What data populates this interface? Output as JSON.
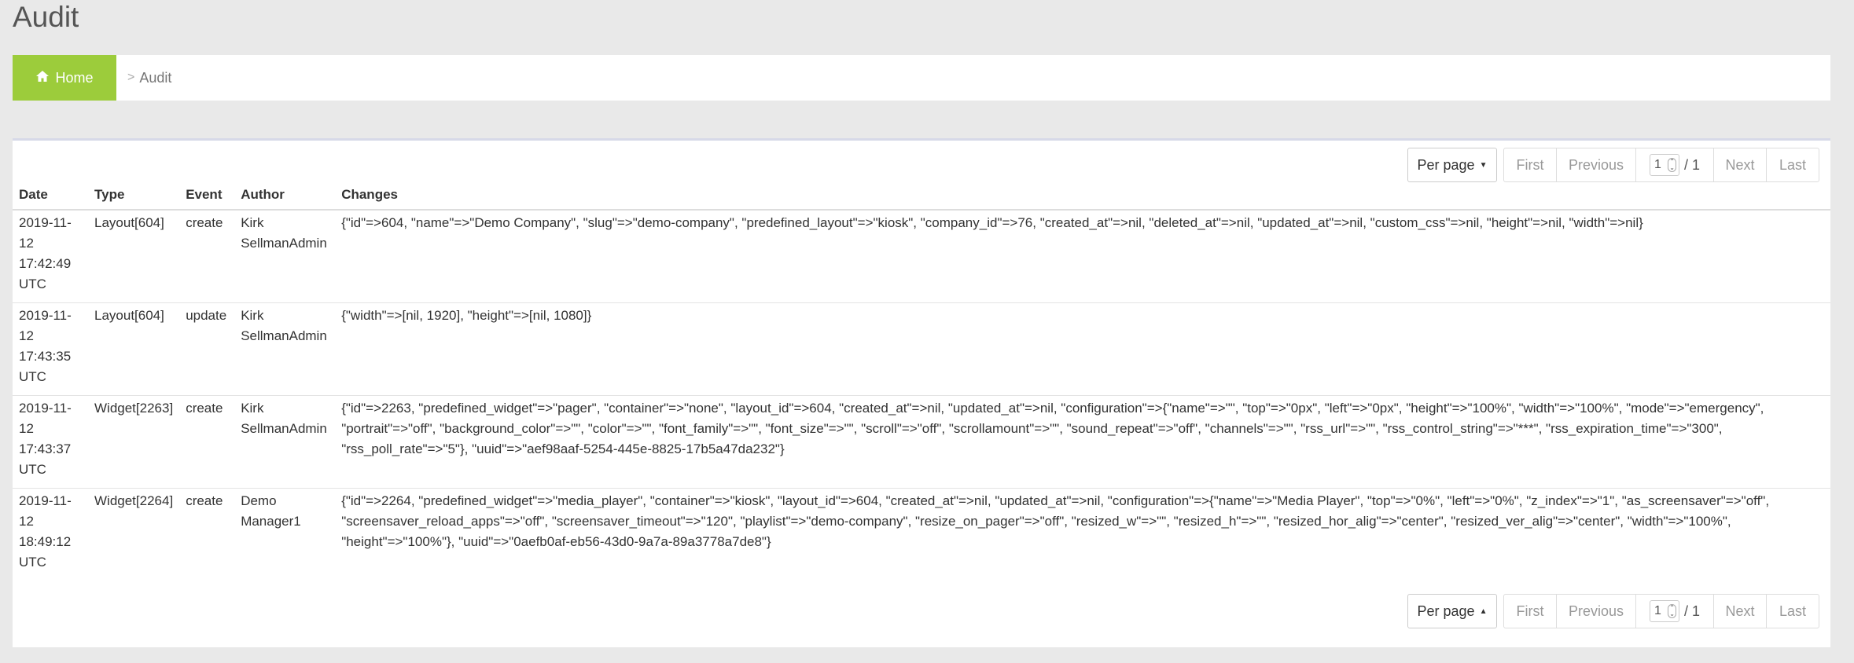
{
  "page": {
    "title": "Audit"
  },
  "breadcrumb": {
    "home": "Home",
    "separator": ">",
    "current": "Audit"
  },
  "pager": {
    "per_page": "Per page",
    "first": "First",
    "previous": "Previous",
    "page_value": "1",
    "page_total": "/ 1",
    "next": "Next",
    "last": "Last"
  },
  "table": {
    "headers": [
      "Date",
      "Type",
      "Event",
      "Author",
      "Changes"
    ],
    "rows": [
      {
        "date": [
          "2019-11-",
          "12",
          "17:42:49",
          "UTC"
        ],
        "type": "Layout[604]",
        "event": "create",
        "author": [
          "Kirk",
          "SellmanAdmin"
        ],
        "changes": "{\"id\"=>604, \"name\"=>\"Demo Company\", \"slug\"=>\"demo-company\", \"predefined_layout\"=>\"kiosk\", \"company_id\"=>76, \"created_at\"=>nil, \"deleted_at\"=>nil, \"updated_at\"=>nil, \"custom_css\"=>nil, \"height\"=>nil, \"width\"=>nil}"
      },
      {
        "date": [
          "2019-11-",
          "12",
          "17:43:35",
          "UTC"
        ],
        "type": "Layout[604]",
        "event": "update",
        "author": [
          "Kirk",
          "SellmanAdmin"
        ],
        "changes": "{\"width\"=>[nil, 1920], \"height\"=>[nil, 1080]}"
      },
      {
        "date": [
          "2019-11-",
          "12",
          "17:43:37",
          "UTC"
        ],
        "type": "Widget[2263]",
        "event": "create",
        "author": [
          "Kirk",
          "SellmanAdmin"
        ],
        "changes": "{\"id\"=>2263, \"predefined_widget\"=>\"pager\", \"container\"=>\"none\", \"layout_id\"=>604, \"created_at\"=>nil, \"updated_at\"=>nil, \"configuration\"=>{\"name\"=>\"\", \"top\"=>\"0px\", \"left\"=>\"0px\", \"height\"=>\"100%\", \"width\"=>\"100%\", \"mode\"=>\"emergency\", \"portrait\"=>\"off\", \"background_color\"=>\"\", \"color\"=>\"\", \"font_family\"=>\"\", \"font_size\"=>\"\", \"scroll\"=>\"off\", \"scrollamount\"=>\"\", \"sound_repeat\"=>\"off\", \"channels\"=>\"\", \"rss_url\"=>\"\", \"rss_control_string\"=>\"***\", \"rss_expiration_time\"=>\"300\", \"rss_poll_rate\"=>\"5\"}, \"uuid\"=>\"aef98aaf-5254-445e-8825-17b5a47da232\"}"
      },
      {
        "date": [
          "2019-11-",
          "12",
          "18:49:12",
          "UTC"
        ],
        "type": "Widget[2264]",
        "event": "create",
        "author": [
          "Demo",
          "Manager1"
        ],
        "changes": "{\"id\"=>2264, \"predefined_widget\"=>\"media_player\", \"container\"=>\"kiosk\", \"layout_id\"=>604, \"created_at\"=>nil, \"updated_at\"=>nil, \"configuration\"=>{\"name\"=>\"Media Player\", \"top\"=>\"0%\", \"left\"=>\"0%\", \"z_index\"=>\"1\", \"as_screensaver\"=>\"off\", \"screensaver_reload_apps\"=>\"off\", \"screensaver_timeout\"=>\"120\", \"playlist\"=>\"demo-company\", \"resize_on_pager\"=>\"off\", \"resized_w\"=>\"\", \"resized_h\"=>\"\", \"resized_hor_alig\"=>\"center\", \"resized_ver_alig\"=>\"center\", \"width\"=>\"100%\", \"height\"=>\"100%\"}, \"uuid\"=>\"0aefb0af-eb56-43d0-9a7a-89a3778a7de8\"}"
      }
    ]
  },
  "colors": {
    "home_bg": "#9ccc3b",
    "page_bg": "#e9e9e9",
    "panel_border": "#d7d9e8"
  },
  "icons": {
    "home": "home-icon",
    "caret_down": "caret-down-icon",
    "caret_up": "caret-up-icon"
  }
}
